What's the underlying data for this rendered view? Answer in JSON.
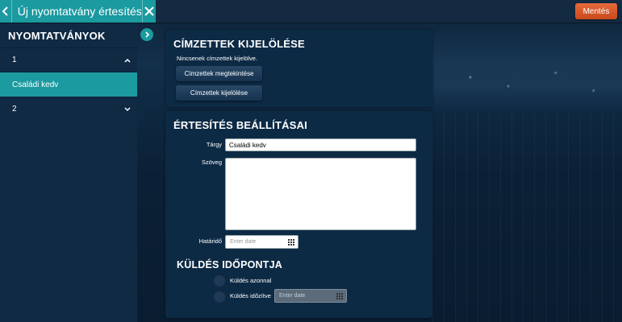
{
  "header": {
    "title": "Új nyomtatvány értesítés",
    "save_label": "Mentés"
  },
  "sidebar": {
    "heading": "NYOMTATVÁNYOK",
    "items": [
      {
        "label": "1",
        "state": "expanded"
      },
      {
        "label": "Családi kedv",
        "state": "selected"
      },
      {
        "label": "2",
        "state": "collapsed"
      }
    ]
  },
  "recipients": {
    "title": "CÍMZETTEK KIJELÖLÉSE",
    "status": "Nincsenek címzettek kijelölve.",
    "view_button": "Címzettek megtekintése",
    "select_button": "Címzettek kijelölése"
  },
  "settings": {
    "title": "ÉRTESÍTÉS BEÁLLÍTÁSAI",
    "subject_label": "Tárgy",
    "subject_value": "Családi kedv",
    "text_label": "Szöveg",
    "text_value": "",
    "deadline_label": "Határidő",
    "deadline_placeholder": "Enter date",
    "send_time_title": "KÜLDÉS IDŐPONTJA",
    "send_now_label": "Küldés azonnal",
    "send_scheduled_label": "Küldés időzítve",
    "scheduled_placeholder": "Enter date"
  },
  "colors": {
    "accent": "#1b9aa0",
    "save_button": "#d9572a",
    "panel": "#0d2a45"
  },
  "icons": {
    "back": "chevron-left-icon",
    "close": "close-icon",
    "collapse": "chevron-right-icon",
    "expanded": "chevron-up-icon",
    "collapsed": "chevron-down-icon",
    "calendar": "calendar-grid-icon"
  }
}
